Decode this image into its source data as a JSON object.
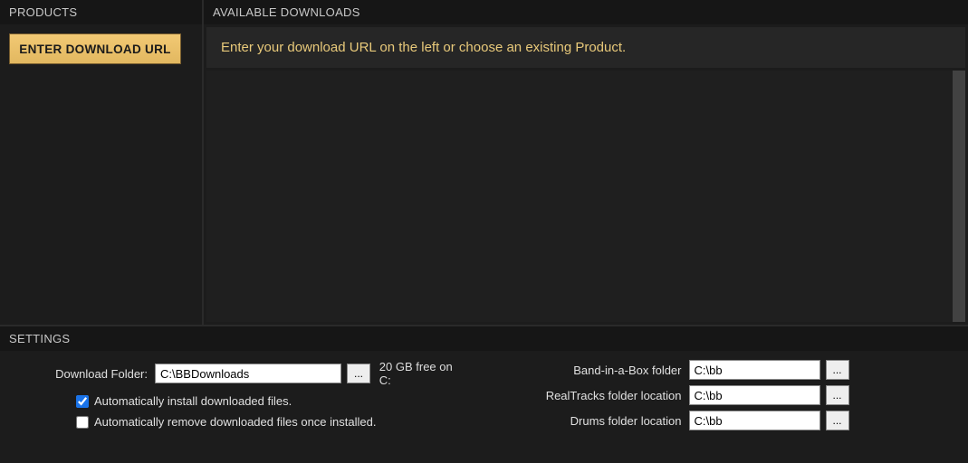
{
  "products": {
    "header": "PRODUCTS",
    "enter_url_button": "ENTER DOWNLOAD URL"
  },
  "downloads": {
    "header": "AVAILABLE DOWNLOADS",
    "banner": "Enter your download URL on the left or choose an existing Product."
  },
  "settings": {
    "header": "SETTINGS",
    "download_folder": {
      "label": "Download Folder:",
      "value": "C:\\BBDownloads",
      "browse": "...",
      "free_space": "20 GB free on C:"
    },
    "auto_install": {
      "label": "Automatically install downloaded files.",
      "checked": true
    },
    "auto_remove": {
      "label": "Automatically remove downloaded files once installed.",
      "checked": false
    },
    "bib_folder": {
      "label": "Band-in-a-Box folder",
      "value": "C:\\bb",
      "browse": "..."
    },
    "rt_folder": {
      "label": "RealTracks folder location",
      "value": "C:\\bb",
      "browse": "..."
    },
    "drums_folder": {
      "label": "Drums folder location",
      "value": "C:\\bb",
      "browse": "..."
    }
  }
}
